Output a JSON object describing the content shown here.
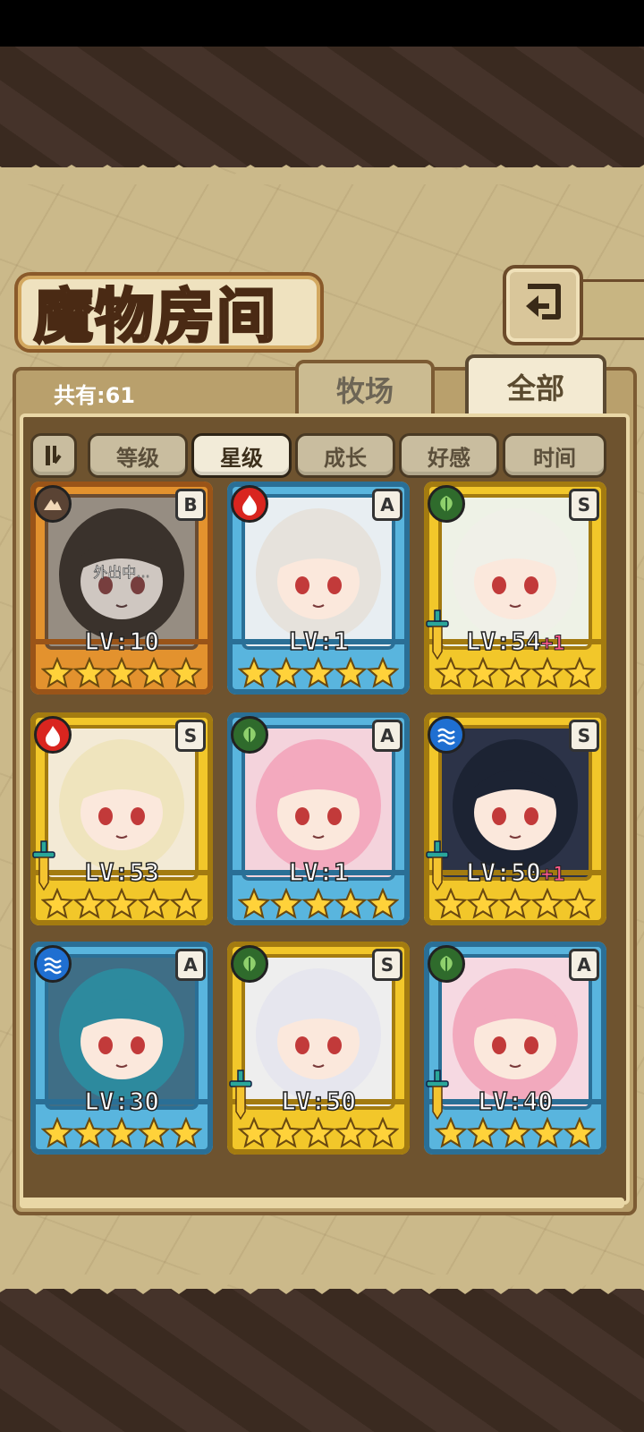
{
  "title": "魔物房间",
  "count_label": "共有:61",
  "tabs": [
    {
      "label": "牧场",
      "active": false
    },
    {
      "label": "全部",
      "active": true
    }
  ],
  "sort_buttons": [
    {
      "label": "等级",
      "active": false
    },
    {
      "label": "星级",
      "active": true
    },
    {
      "label": "成长",
      "active": false
    },
    {
      "label": "好感",
      "active": false
    },
    {
      "label": "时间",
      "active": false
    }
  ],
  "colors": {
    "rank_B": "#e3922e",
    "rank_A": "#59b5de",
    "rank_S": "#f2c72a",
    "fire": "#d9251f",
    "earth": "#5a4334",
    "grass": "#2f6b2c",
    "water": "#1f6fd1"
  },
  "cards": [
    {
      "rank": "B",
      "element": "earth-icon",
      "level": "LV:10",
      "plus": "",
      "stars": 5,
      "status": "外出中...",
      "sword": false
    },
    {
      "rank": "A",
      "element": "fire-icon",
      "level": "LV:1",
      "plus": "",
      "stars": 5,
      "status": "",
      "sword": false
    },
    {
      "rank": "S",
      "element": "leaf-icon",
      "level": "LV:54",
      "plus": "+1",
      "stars": 5,
      "status": "",
      "sword": true
    },
    {
      "rank": "S",
      "element": "fire-icon",
      "level": "LV:53",
      "plus": "",
      "stars": 5,
      "status": "",
      "sword": true
    },
    {
      "rank": "A",
      "element": "leaf-icon",
      "level": "LV:1",
      "plus": "",
      "stars": 5,
      "status": "",
      "sword": false
    },
    {
      "rank": "S",
      "element": "water-icon",
      "level": "LV:50",
      "plus": "+1",
      "stars": 5,
      "status": "",
      "sword": true
    },
    {
      "rank": "A",
      "element": "water-icon",
      "level": "LV:30",
      "plus": "",
      "stars": 5,
      "status": "",
      "sword": false
    },
    {
      "rank": "S",
      "element": "leaf-icon",
      "level": "LV:50",
      "plus": "",
      "stars": 5,
      "status": "",
      "sword": true
    },
    {
      "rank": "A",
      "element": "leaf-icon",
      "level": "LV:40",
      "plus": "",
      "stars": 5,
      "status": "",
      "sword": true
    }
  ]
}
